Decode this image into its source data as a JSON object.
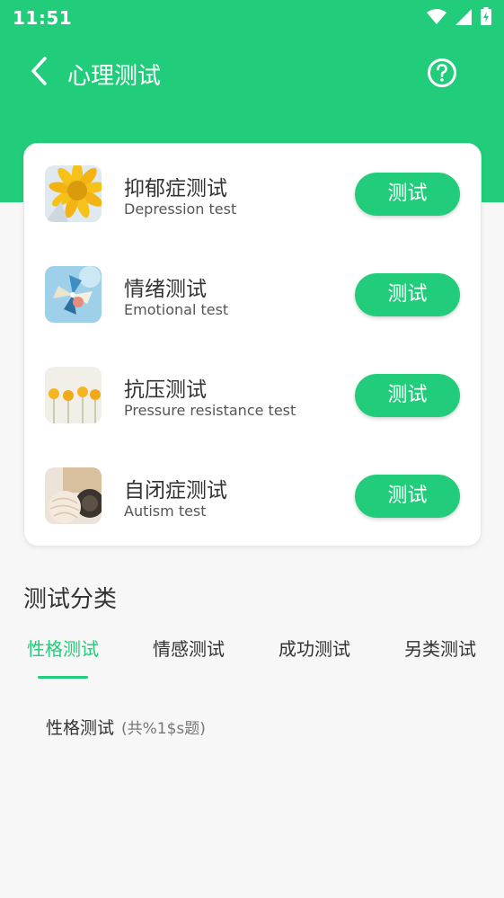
{
  "status_bar": {
    "time": "11:51"
  },
  "toolbar": {
    "title": "心理测试"
  },
  "tests": [
    {
      "title": "抑郁症测试",
      "subtitle": "Depression test",
      "button": "测试"
    },
    {
      "title": "情绪测试",
      "subtitle": "Emotional test",
      "button": "测试"
    },
    {
      "title": "抗压测试",
      "subtitle": "Pressure resistance test",
      "button": "测试"
    },
    {
      "title": "自闭症测试",
      "subtitle": "Autism test",
      "button": "测试"
    }
  ],
  "categories": {
    "section_title": "测试分类",
    "tabs": [
      "性格测试",
      "情感测试",
      "成功测试",
      "另类测试"
    ],
    "active_tab": "性格测试"
  },
  "list": {
    "heading": "性格测试",
    "count": "(共%1$s题)"
  },
  "colors": {
    "accent": "#21cc7a"
  }
}
